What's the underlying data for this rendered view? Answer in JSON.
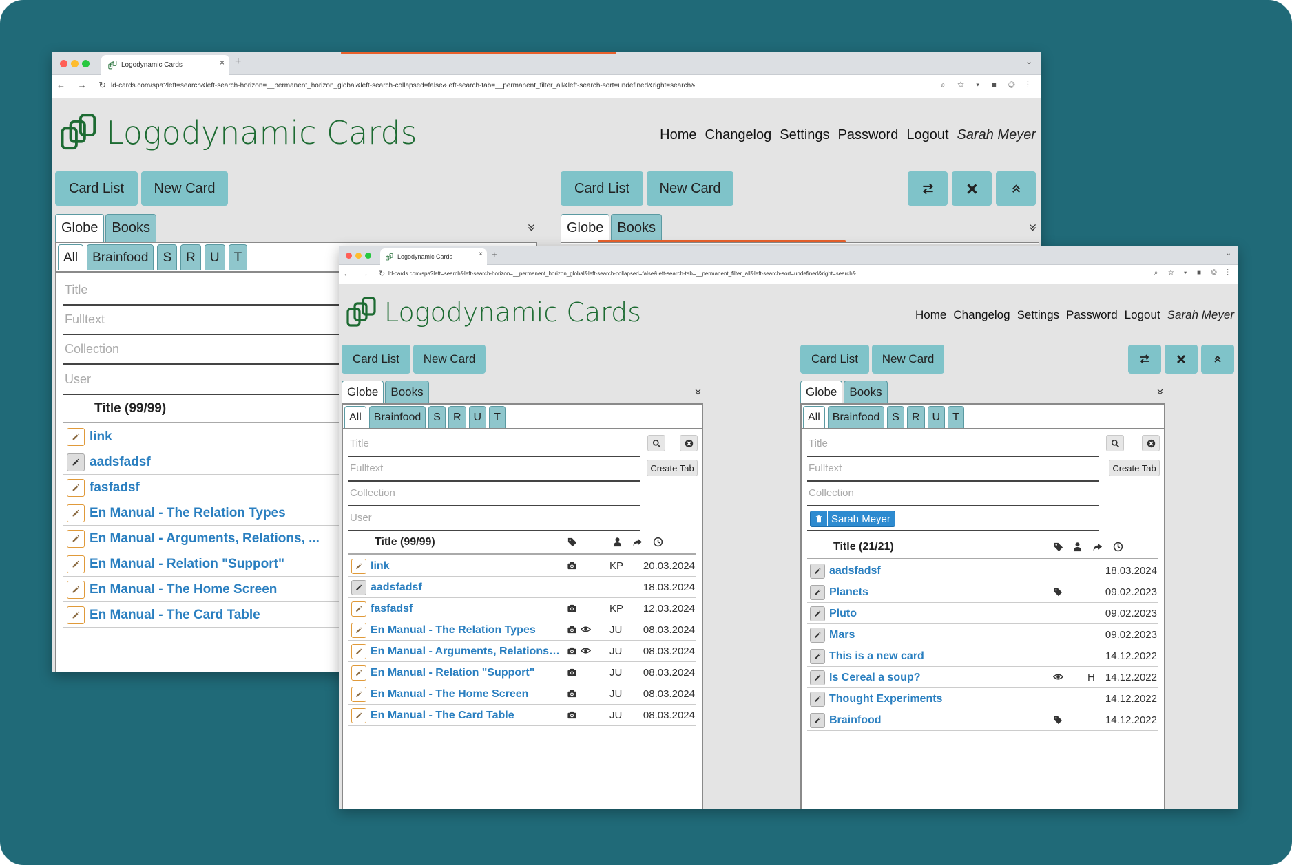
{
  "browser": {
    "tab_title": "Logodynamic Cards",
    "url": "ld-cards.com/spa?left=search&left-search-horizon=__permanent_horizon_global&left-search-collapsed=false&left-search-tab=__permanent_filter_all&left-search-sort=undefined&right=search&"
  },
  "app": {
    "logo_text": "Logodynamic Cards",
    "nav": [
      "Home",
      "Changelog",
      "Settings",
      "Password",
      "Logout"
    ],
    "user": "Sarah Meyer"
  },
  "toolbar": {
    "card_list": "Card List",
    "new_card": "New Card"
  },
  "horizon_tabs": [
    "Globe",
    "Books"
  ],
  "filter_tabs": [
    "All",
    "Brainfood",
    "S",
    "R",
    "U",
    "T"
  ],
  "fields": {
    "title": "Title",
    "fulltext": "Fulltext",
    "collection": "Collection",
    "user": "User"
  },
  "create_tab": "Create Tab",
  "left_pane": {
    "header": "Title (99/99)",
    "rows": [
      {
        "title": "link",
        "camera": true,
        "eye": false,
        "tag": false,
        "user": "KP",
        "date": "20.03.2024",
        "alt": false
      },
      {
        "title": "aadsfadsf",
        "camera": false,
        "eye": false,
        "tag": false,
        "user": "",
        "date": "18.03.2024",
        "alt": true
      },
      {
        "title": "fasfadsf",
        "camera": true,
        "eye": false,
        "tag": false,
        "user": "KP",
        "date": "12.03.2024",
        "alt": false
      },
      {
        "title": "En Manual - The Relation Types",
        "camera": true,
        "eye": true,
        "tag": false,
        "user": "JU",
        "date": "08.03.2024",
        "alt": false
      },
      {
        "title": "En Manual - Arguments, Relations, ...",
        "camera": true,
        "eye": true,
        "tag": false,
        "user": "JU",
        "date": "08.03.2024",
        "alt": false
      },
      {
        "title": "En Manual - Relation \"Support\"",
        "camera": true,
        "eye": false,
        "tag": false,
        "user": "JU",
        "date": "08.03.2024",
        "alt": false
      },
      {
        "title": "En Manual - The Home Screen",
        "camera": true,
        "eye": false,
        "tag": false,
        "user": "JU",
        "date": "08.03.2024",
        "alt": false
      },
      {
        "title": "En Manual - The Card Table",
        "camera": true,
        "eye": false,
        "tag": false,
        "user": "JU",
        "date": "08.03.2024",
        "alt": false
      }
    ]
  },
  "right_pane": {
    "header": "Title (21/21)",
    "user_chip": "Sarah Meyer",
    "rows": [
      {
        "title": "aadsfadsf",
        "camera": false,
        "eye": false,
        "tag": false,
        "user": "",
        "date": "18.03.2024",
        "alt": true
      },
      {
        "title": "Planets",
        "camera": false,
        "eye": false,
        "tag": true,
        "user": "",
        "date": "09.02.2023",
        "alt": true
      },
      {
        "title": "Pluto",
        "camera": false,
        "eye": false,
        "tag": false,
        "user": "",
        "date": "09.02.2023",
        "alt": true
      },
      {
        "title": "Mars",
        "camera": false,
        "eye": false,
        "tag": false,
        "user": "",
        "date": "09.02.2023",
        "alt": true
      },
      {
        "title": "This is a new card",
        "camera": false,
        "eye": false,
        "tag": false,
        "user": "",
        "date": "14.12.2022",
        "alt": true
      },
      {
        "title": "Is Cereal a soup?",
        "camera": false,
        "eye": true,
        "tag": false,
        "user": "H",
        "date": "14.12.2022",
        "alt": true
      },
      {
        "title": "Thought Experiments",
        "camera": false,
        "eye": false,
        "tag": false,
        "user": "",
        "date": "14.12.2022",
        "alt": true
      },
      {
        "title": "Brainfood",
        "camera": false,
        "eye": false,
        "tag": true,
        "user": "",
        "date": "14.12.2022",
        "alt": true
      }
    ]
  },
  "colors": {
    "background": "#206a78",
    "button": "#7fc3c9",
    "logo": "#1d6b32",
    "link": "#2a7fc0",
    "chip": "#2e8bd0"
  },
  "icons": [
    "logo-icon",
    "swap-icon",
    "close-icon",
    "collapse-icon",
    "chevron-down-icon",
    "search-icon",
    "clear-icon",
    "edit-icon",
    "camera-icon",
    "eye-icon",
    "tag-icon",
    "person-icon",
    "share-icon",
    "clock-icon",
    "trash-icon"
  ]
}
